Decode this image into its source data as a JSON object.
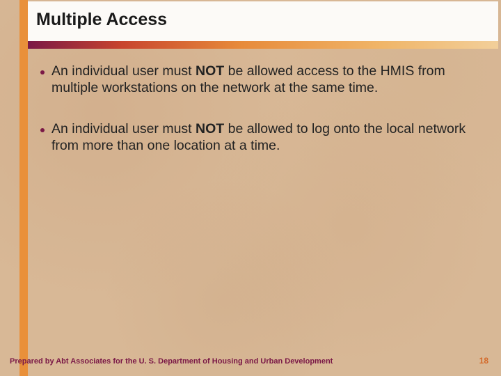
{
  "title": "Multiple Access",
  "bullets": [
    {
      "pre": "An individual user must ",
      "bold": "NOT",
      "post": " be allowed access to the HMIS from multiple workstations on the network at the same time."
    },
    {
      "pre": "An individual user must ",
      "bold": "NOT",
      "post": " be allowed to log onto the local network from more than one location at a time."
    }
  ],
  "footer": {
    "left": "Prepared by Abt Associates for the U. S. Department of Housing and Urban Development",
    "page": "18"
  },
  "colors": {
    "accent_orange": "#e9903a",
    "accent_purple": "#7a1846"
  }
}
